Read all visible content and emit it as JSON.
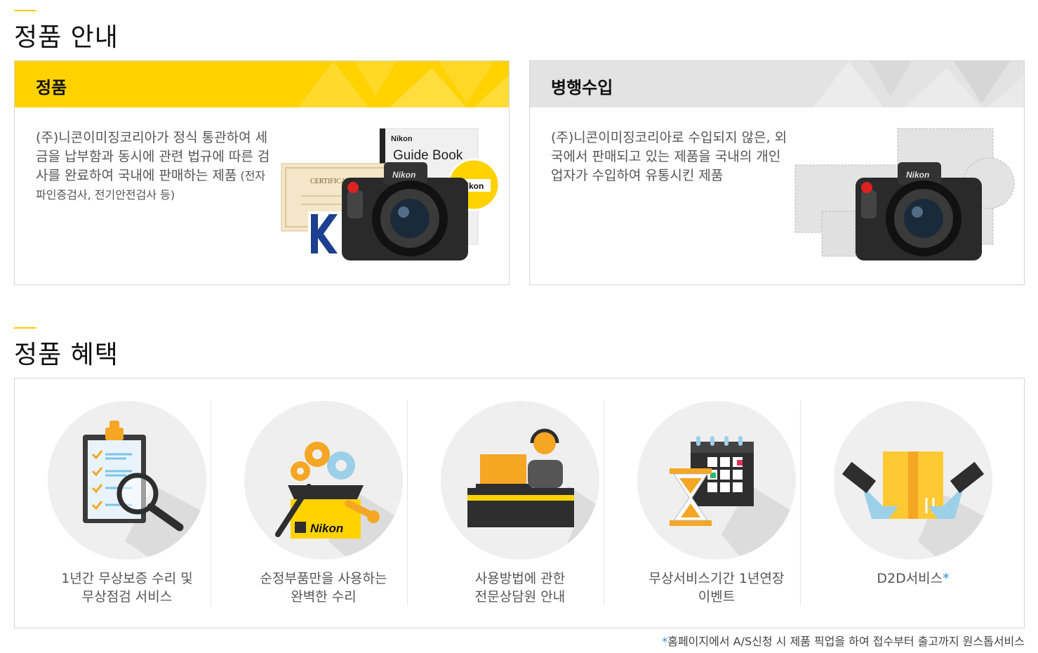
{
  "sections": {
    "info_title": "정품 안내",
    "benefit_title": "정품 혜택"
  },
  "cards": {
    "genuine": {
      "title": "정품",
      "desc_main": "(주)니콘이미징코리아가 정식 통관하여 세금을 납부함과 동시에 관련 법규에 따른 검사를 완료하여 국내에 판매하는 제품",
      "desc_small": " (전자파인증검사, 전기안전검사 등)",
      "guide_brand": "Nikon",
      "guide_title": "Guide Book",
      "certificate": "CERTIFICATE",
      "sticker": "Nikon",
      "camera_brand": "Nikon"
    },
    "parallel": {
      "title": "병행수입",
      "desc": "(주)니콘이미징코리아로 수입되지 않은, 외국에서 판매되고 있는 제품을 국내의 개인업자가 수입하여 유통시킨 제품",
      "camera_brand": "Nikon"
    }
  },
  "benefits": [
    {
      "icon": "clipboard-checklist-icon",
      "line1": "1년간 무상보증 수리 및",
      "line2": "무상점검 서비스"
    },
    {
      "icon": "gear-box-tools-icon",
      "line1": "순정부품만을 사용하는",
      "line2": "완벽한 수리",
      "brand": "Nikon"
    },
    {
      "icon": "consultant-desk-icon",
      "line1": "사용방법에 관한",
      "line2": "전문상담원 안내"
    },
    {
      "icon": "calendar-hourglass-icon",
      "line1": "무상서비스기간 1년연장",
      "line2": "이벤트"
    },
    {
      "icon": "delivery-box-icon",
      "line1": "D2D서비스",
      "star": "*"
    }
  ],
  "footnote": {
    "star": "*",
    "text": "홈페이지에서 A/S신청 시 제품 픽업을 하여 접수부터 출고까지 원스톱서비스"
  },
  "colors": {
    "accent": "#ffd200",
    "gray_head": "#e3e3e3",
    "link_blue": "#2b8fd6"
  }
}
